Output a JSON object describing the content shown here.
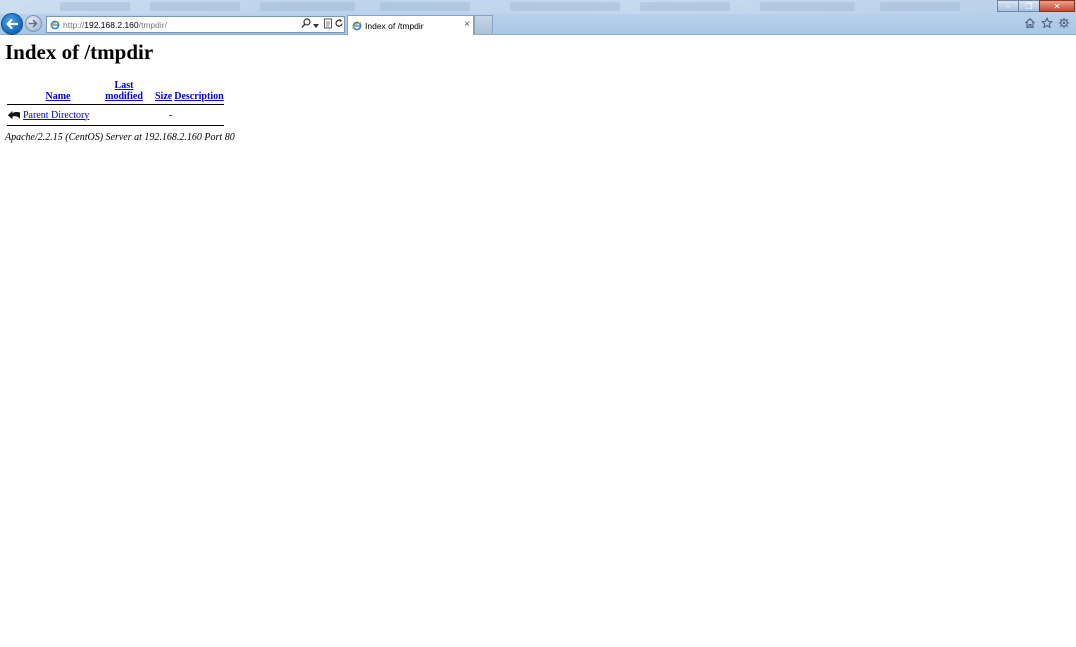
{
  "browser": {
    "address": {
      "protocol": "http://",
      "host": "192.168.2.160",
      "path": "/tmpdir/"
    },
    "active_tab": {
      "title": "Index of /tmpdir",
      "close_glyph": "×"
    },
    "window_controls": {
      "minimize_glyph": "–",
      "restore_glyph": "❐",
      "close_glyph": "✕"
    },
    "icons": [
      "back-arrow-icon",
      "forward-arrow-icon",
      "ie-favicon-icon",
      "search-icon",
      "dropdown-icon",
      "compat-view-icon",
      "refresh-icon",
      "home-icon",
      "favorites-star-icon",
      "settings-gear-icon"
    ],
    "accent_color": "#1466b8"
  },
  "page": {
    "title": "Index of /tmpdir",
    "table": {
      "headers": {
        "name": "Name",
        "last_modified": "Last modified",
        "size": "Size",
        "description": "Description"
      },
      "rows": [
        {
          "icon": "back-arrow-icon",
          "name": "Parent Directory",
          "last_modified": "",
          "size": "-",
          "description": ""
        }
      ]
    },
    "server_signature": "Apache/2.2.15 (CentOS) Server at 192.168.2.160 Port 80",
    "link_color": "#0000ee"
  }
}
